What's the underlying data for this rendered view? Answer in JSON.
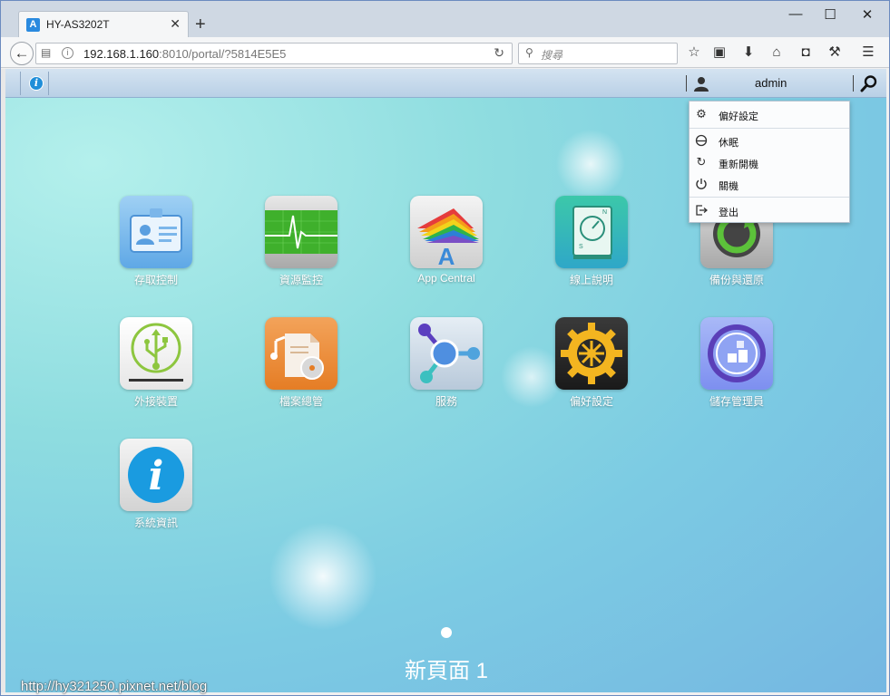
{
  "browser": {
    "tab_title": "HY-AS3202T",
    "tab_favicon": "asustor-logo-icon",
    "url_host": "192.168.1.160",
    "url_rest": ":8010/portal/?5814E5E5",
    "search_placeholder": "搜尋"
  },
  "portal": {
    "username": "admin",
    "user_menu": [
      {
        "label": "偏好設定",
        "icon": "gear-icon"
      },
      {
        "label": "休眠",
        "icon": "sleep-icon"
      },
      {
        "label": "重新開機",
        "icon": "restart-icon"
      },
      {
        "label": "關機",
        "icon": "power-icon"
      },
      {
        "label": "登出",
        "icon": "logout-icon"
      }
    ],
    "apps": [
      {
        "label": "存取控制",
        "icon": "access-control-icon"
      },
      {
        "label": "資源監控",
        "icon": "activity-monitor-icon"
      },
      {
        "label": "App Central",
        "icon": "app-central-icon"
      },
      {
        "label": "線上說明",
        "icon": "online-help-icon"
      },
      {
        "label": "備份與還原",
        "icon": "backup-restore-icon"
      },
      {
        "label": "外接裝置",
        "icon": "external-devices-icon"
      },
      {
        "label": "檔案總管",
        "icon": "file-explorer-icon"
      },
      {
        "label": "服務",
        "icon": "services-icon"
      },
      {
        "label": "偏好設定",
        "icon": "settings-gear-icon"
      },
      {
        "label": "儲存管理員",
        "icon": "storage-manager-icon"
      },
      {
        "label": "系統資訊",
        "icon": "system-info-icon"
      }
    ],
    "page_name": "新頁面 1"
  },
  "watermark": "http://hy321250.pixnet.net/blog"
}
